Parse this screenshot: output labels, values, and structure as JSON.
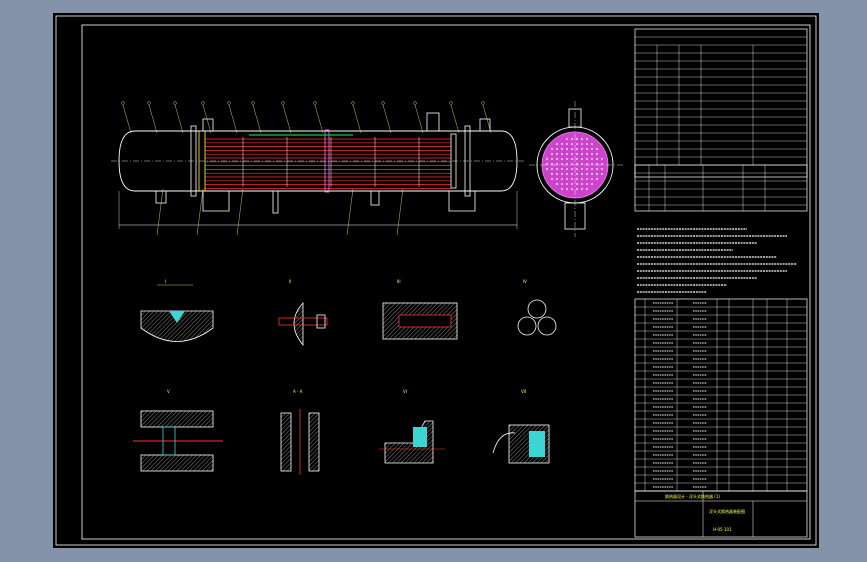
{
  "title_block": {
    "line1": "换热器设计 - 浮头式换热器 (1)",
    "line2": "浮头式换热器装配图",
    "line3": "H-05-101"
  },
  "detail_views": [
    {
      "label": "I"
    },
    {
      "label": "II"
    },
    {
      "label": "III"
    },
    {
      "label": "IV"
    },
    {
      "label": "V"
    },
    {
      "label": "A - A"
    },
    {
      "label": "VI"
    },
    {
      "label": "VII"
    }
  ],
  "colors": {
    "background": "#8593aa",
    "sheet": "#000000",
    "frame": "#ffffff",
    "outline": "#ffffff",
    "tubes": "#ff3030",
    "leader": "#ffff55",
    "baffle": "#00cc44",
    "section_fill": "#3ad6d6",
    "tubesheet_face": "#ff77ff"
  }
}
